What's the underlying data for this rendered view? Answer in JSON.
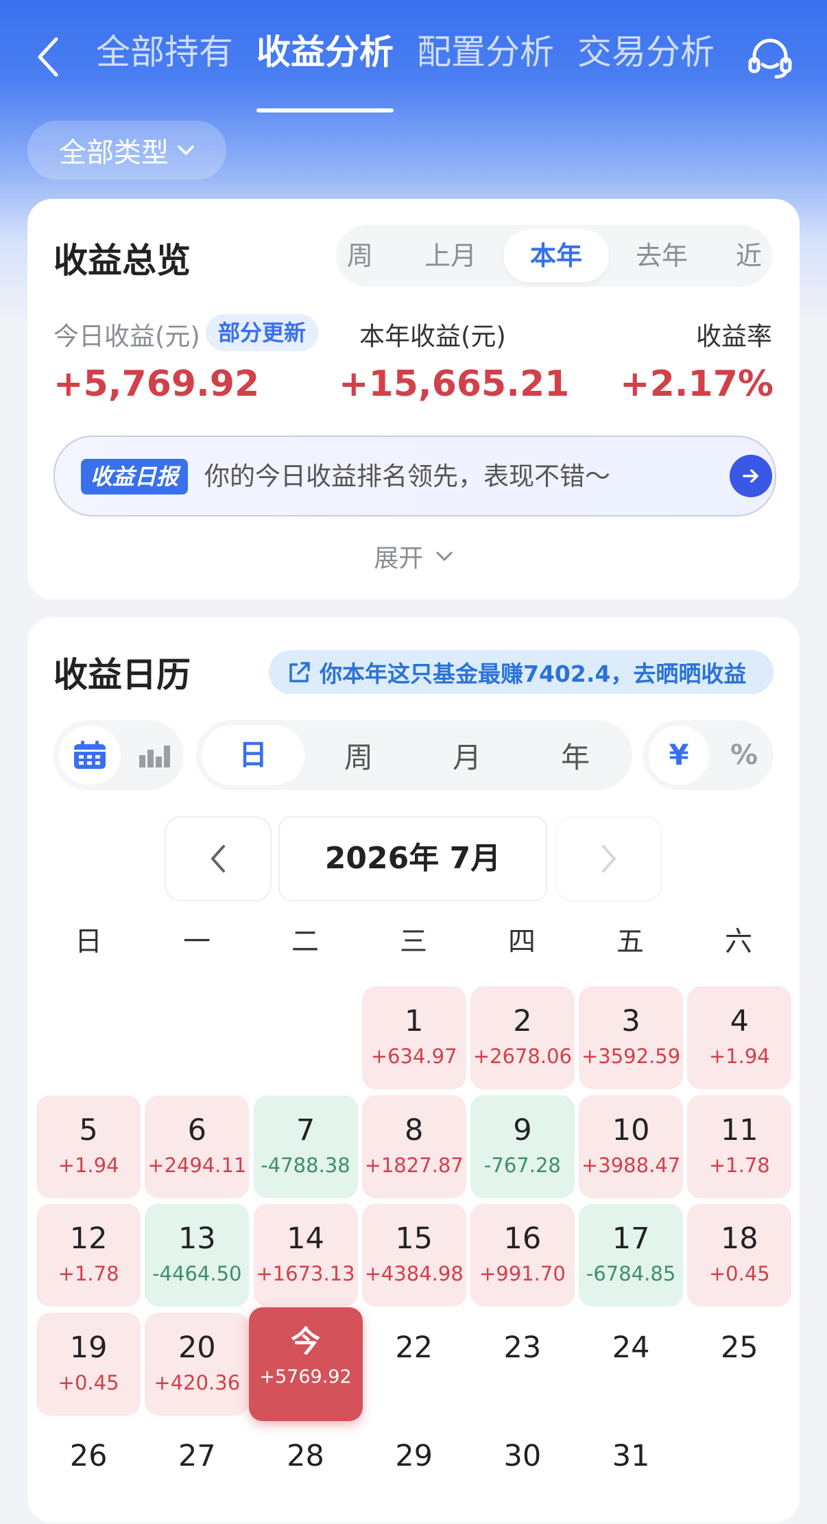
{
  "nav": {
    "tabs": [
      {
        "label": "全部持有"
      },
      {
        "label": "收益分析"
      },
      {
        "label": "配置分析"
      },
      {
        "label": "交易分析"
      }
    ],
    "type_filter": "全部类型"
  },
  "overview": {
    "title": "收益总览",
    "periods": [
      "周",
      "上月",
      "本年",
      "去年",
      "近"
    ],
    "active_period": "本年",
    "today_label": "今日收益(元)",
    "update_badge": "部分更新",
    "today_value": "+5,769.92",
    "year_label": "本年收益(元)",
    "year_value": "+15,665.21",
    "rate_label": "收益率",
    "rate_value": "+2.17%",
    "report_tag": "收益日报",
    "report_text": "你的今日收益排名领先，表现不错～",
    "expand_label": "展开"
  },
  "calendar": {
    "title": "收益日历",
    "share_text": "你本年这只基金最赚7402.4，去晒晒收益",
    "granularity": [
      "日",
      "周",
      "月",
      "年"
    ],
    "unit_active": "¥",
    "unit_other": "%",
    "month_label": "2026年 7月",
    "weekdays": [
      "日",
      "一",
      "二",
      "三",
      "四",
      "五",
      "六"
    ],
    "days": [
      {
        "day": "1",
        "value": "+634.97",
        "kind": "gain"
      },
      {
        "day": "2",
        "value": "+2678.06",
        "kind": "gain"
      },
      {
        "day": "3",
        "value": "+3592.59",
        "kind": "gain"
      },
      {
        "day": "4",
        "value": "+1.94",
        "kind": "gain"
      },
      {
        "day": "5",
        "value": "+1.94",
        "kind": "gain"
      },
      {
        "day": "6",
        "value": "+2494.11",
        "kind": "gain"
      },
      {
        "day": "7",
        "value": "-4788.38",
        "kind": "loss"
      },
      {
        "day": "8",
        "value": "+1827.87",
        "kind": "gain"
      },
      {
        "day": "9",
        "value": "-767.28",
        "kind": "loss"
      },
      {
        "day": "10",
        "value": "+3988.47",
        "kind": "gain"
      },
      {
        "day": "11",
        "value": "+1.78",
        "kind": "gain"
      },
      {
        "day": "12",
        "value": "+1.78",
        "kind": "gain"
      },
      {
        "day": "13",
        "value": "-4464.50",
        "kind": "loss"
      },
      {
        "day": "14",
        "value": "+1673.13",
        "kind": "gain"
      },
      {
        "day": "15",
        "value": "+4384.98",
        "kind": "gain"
      },
      {
        "day": "16",
        "value": "+991.70",
        "kind": "gain"
      },
      {
        "day": "17",
        "value": "-6784.85",
        "kind": "loss"
      },
      {
        "day": "18",
        "value": "+0.45",
        "kind": "gain"
      },
      {
        "day": "19",
        "value": "+0.45",
        "kind": "gain"
      },
      {
        "day": "20",
        "value": "+420.36",
        "kind": "gain"
      },
      {
        "day": "今",
        "value": "+5769.92",
        "kind": "today"
      },
      {
        "day": "22",
        "value": "",
        "kind": "empty"
      },
      {
        "day": "23",
        "value": "",
        "kind": "empty"
      },
      {
        "day": "24",
        "value": "",
        "kind": "empty"
      },
      {
        "day": "25",
        "value": "",
        "kind": "empty"
      },
      {
        "day": "26",
        "value": "",
        "kind": "empty"
      },
      {
        "day": "27",
        "value": "",
        "kind": "empty"
      },
      {
        "day": "28",
        "value": "",
        "kind": "empty"
      },
      {
        "day": "29",
        "value": "",
        "kind": "empty"
      },
      {
        "day": "30",
        "value": "",
        "kind": "empty"
      },
      {
        "day": "31",
        "value": "",
        "kind": "empty"
      }
    ]
  },
  "colors": {
    "brand_blue": "#3a70ee",
    "gain_red": "#d2404a",
    "loss_green": "#3f8e6a"
  }
}
